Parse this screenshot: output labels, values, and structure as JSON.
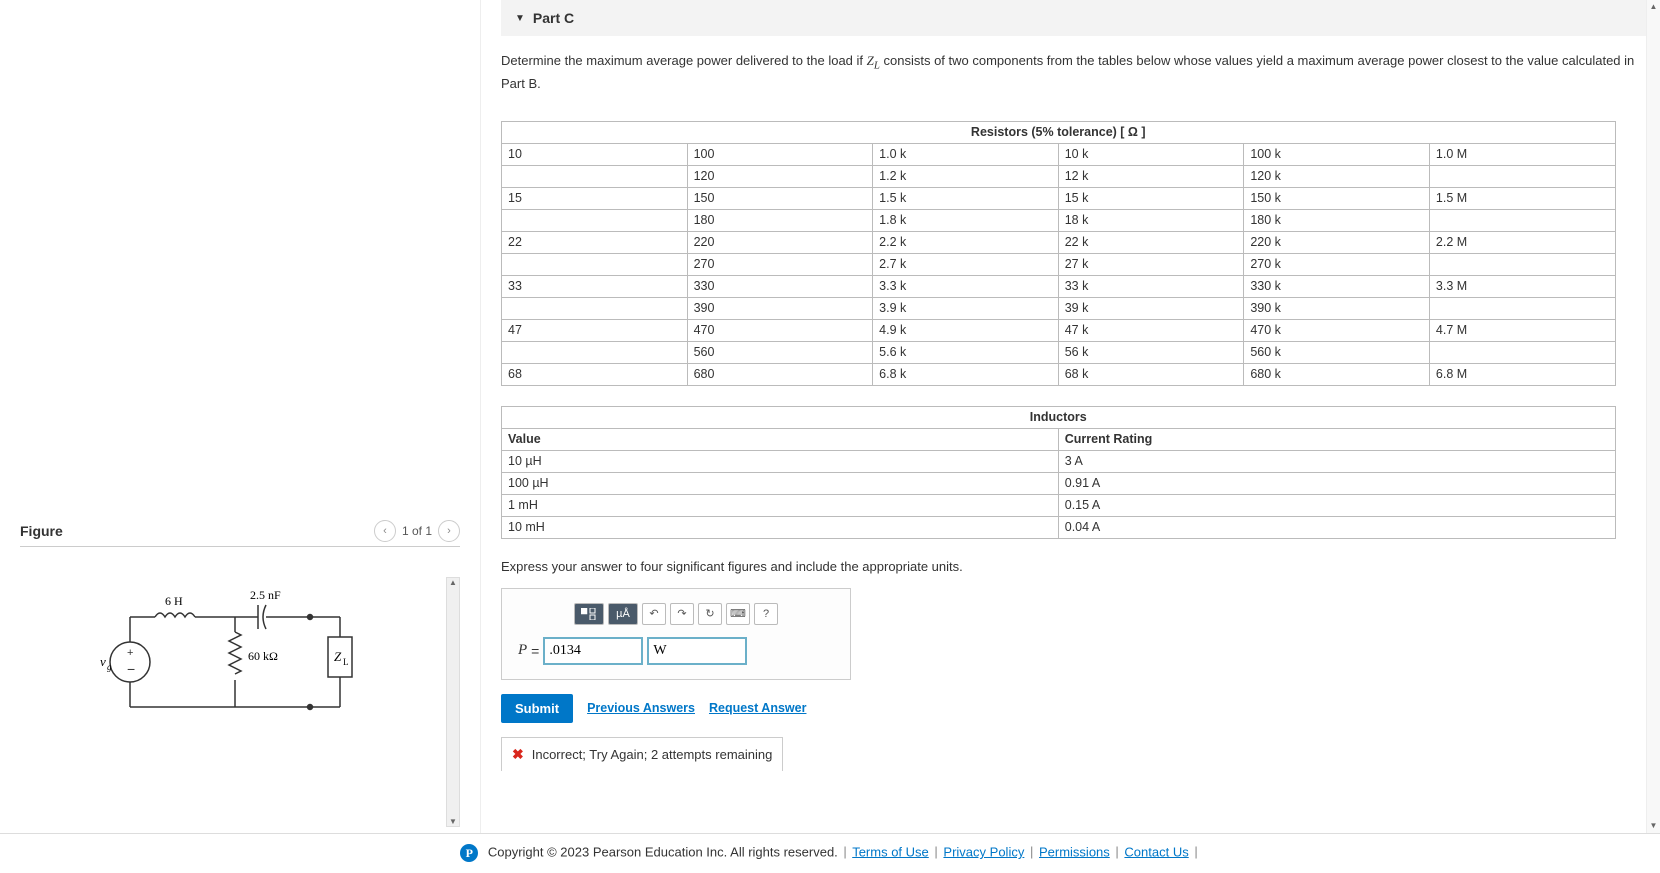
{
  "figure": {
    "title": "Figure",
    "counter": "1 of 1",
    "labels": {
      "ind": "6 H",
      "cap": "2.5 nF",
      "res": "60 kΩ",
      "zl": "Z",
      "zl_sub": "L",
      "vg": "v",
      "vg_sub": "g"
    }
  },
  "partC": {
    "title": "Part C",
    "prompt_pre": "Determine the maximum average power delivered to the load if ",
    "prompt_var": "Z",
    "prompt_var_sub": "L",
    "prompt_post": " consists of two components from the tables below whose values yield a maximum average power closest to the value calculated in Part B.",
    "resistor_table": {
      "header": "Resistors (5% tolerance) [ Ω ]",
      "rows": [
        [
          "10",
          "100",
          "1.0 k",
          "10 k",
          "100 k",
          "1.0 M"
        ],
        [
          "",
          "120",
          "1.2 k",
          "12 k",
          "120 k",
          ""
        ],
        [
          "15",
          "150",
          "1.5 k",
          "15 k",
          "150 k",
          "1.5 M"
        ],
        [
          "",
          "180",
          "1.8 k",
          "18 k",
          "180 k",
          ""
        ],
        [
          "22",
          "220",
          "2.2 k",
          "22 k",
          "220 k",
          "2.2 M"
        ],
        [
          "",
          "270",
          "2.7 k",
          "27 k",
          "270 k",
          ""
        ],
        [
          "33",
          "330",
          "3.3 k",
          "33 k",
          "330 k",
          "3.3 M"
        ],
        [
          "",
          "390",
          "3.9 k",
          "39 k",
          "390 k",
          ""
        ],
        [
          "47",
          "470",
          "4.9 k",
          "47 k",
          "470 k",
          "4.7 M"
        ],
        [
          "",
          "560",
          "5.6 k",
          "56 k",
          "560 k",
          ""
        ],
        [
          "68",
          "680",
          "6.8 k",
          "68 k",
          "680 k",
          "6.8 M"
        ]
      ]
    },
    "inductor_table": {
      "header": "Inductors",
      "col1": "Value",
      "col2": "Current Rating",
      "rows": [
        [
          "10 µH",
          "3 A"
        ],
        [
          "100 µH",
          "0.91 A"
        ],
        [
          "1 mH",
          "0.15 A"
        ],
        [
          "10 mH",
          "0.04 A"
        ]
      ]
    },
    "express": "Express your answer to four significant figures and include the appropriate units.",
    "toolbar": {
      "units_ua": "µÅ",
      "help": "?"
    },
    "answer": {
      "symbol": "P",
      "equals": "=",
      "value": ".0134",
      "unit": "W"
    },
    "submit": "Submit",
    "prev_answers": "Previous Answers",
    "request_answer": "Request Answer",
    "feedback": "Incorrect; Try Again; 2 attempts remaining"
  },
  "footer": {
    "copyright": "Copyright © 2023  Pearson Education Inc. All rights reserved.",
    "links": [
      "Terms of Use",
      "Privacy Policy",
      "Permissions",
      "Contact Us"
    ]
  }
}
